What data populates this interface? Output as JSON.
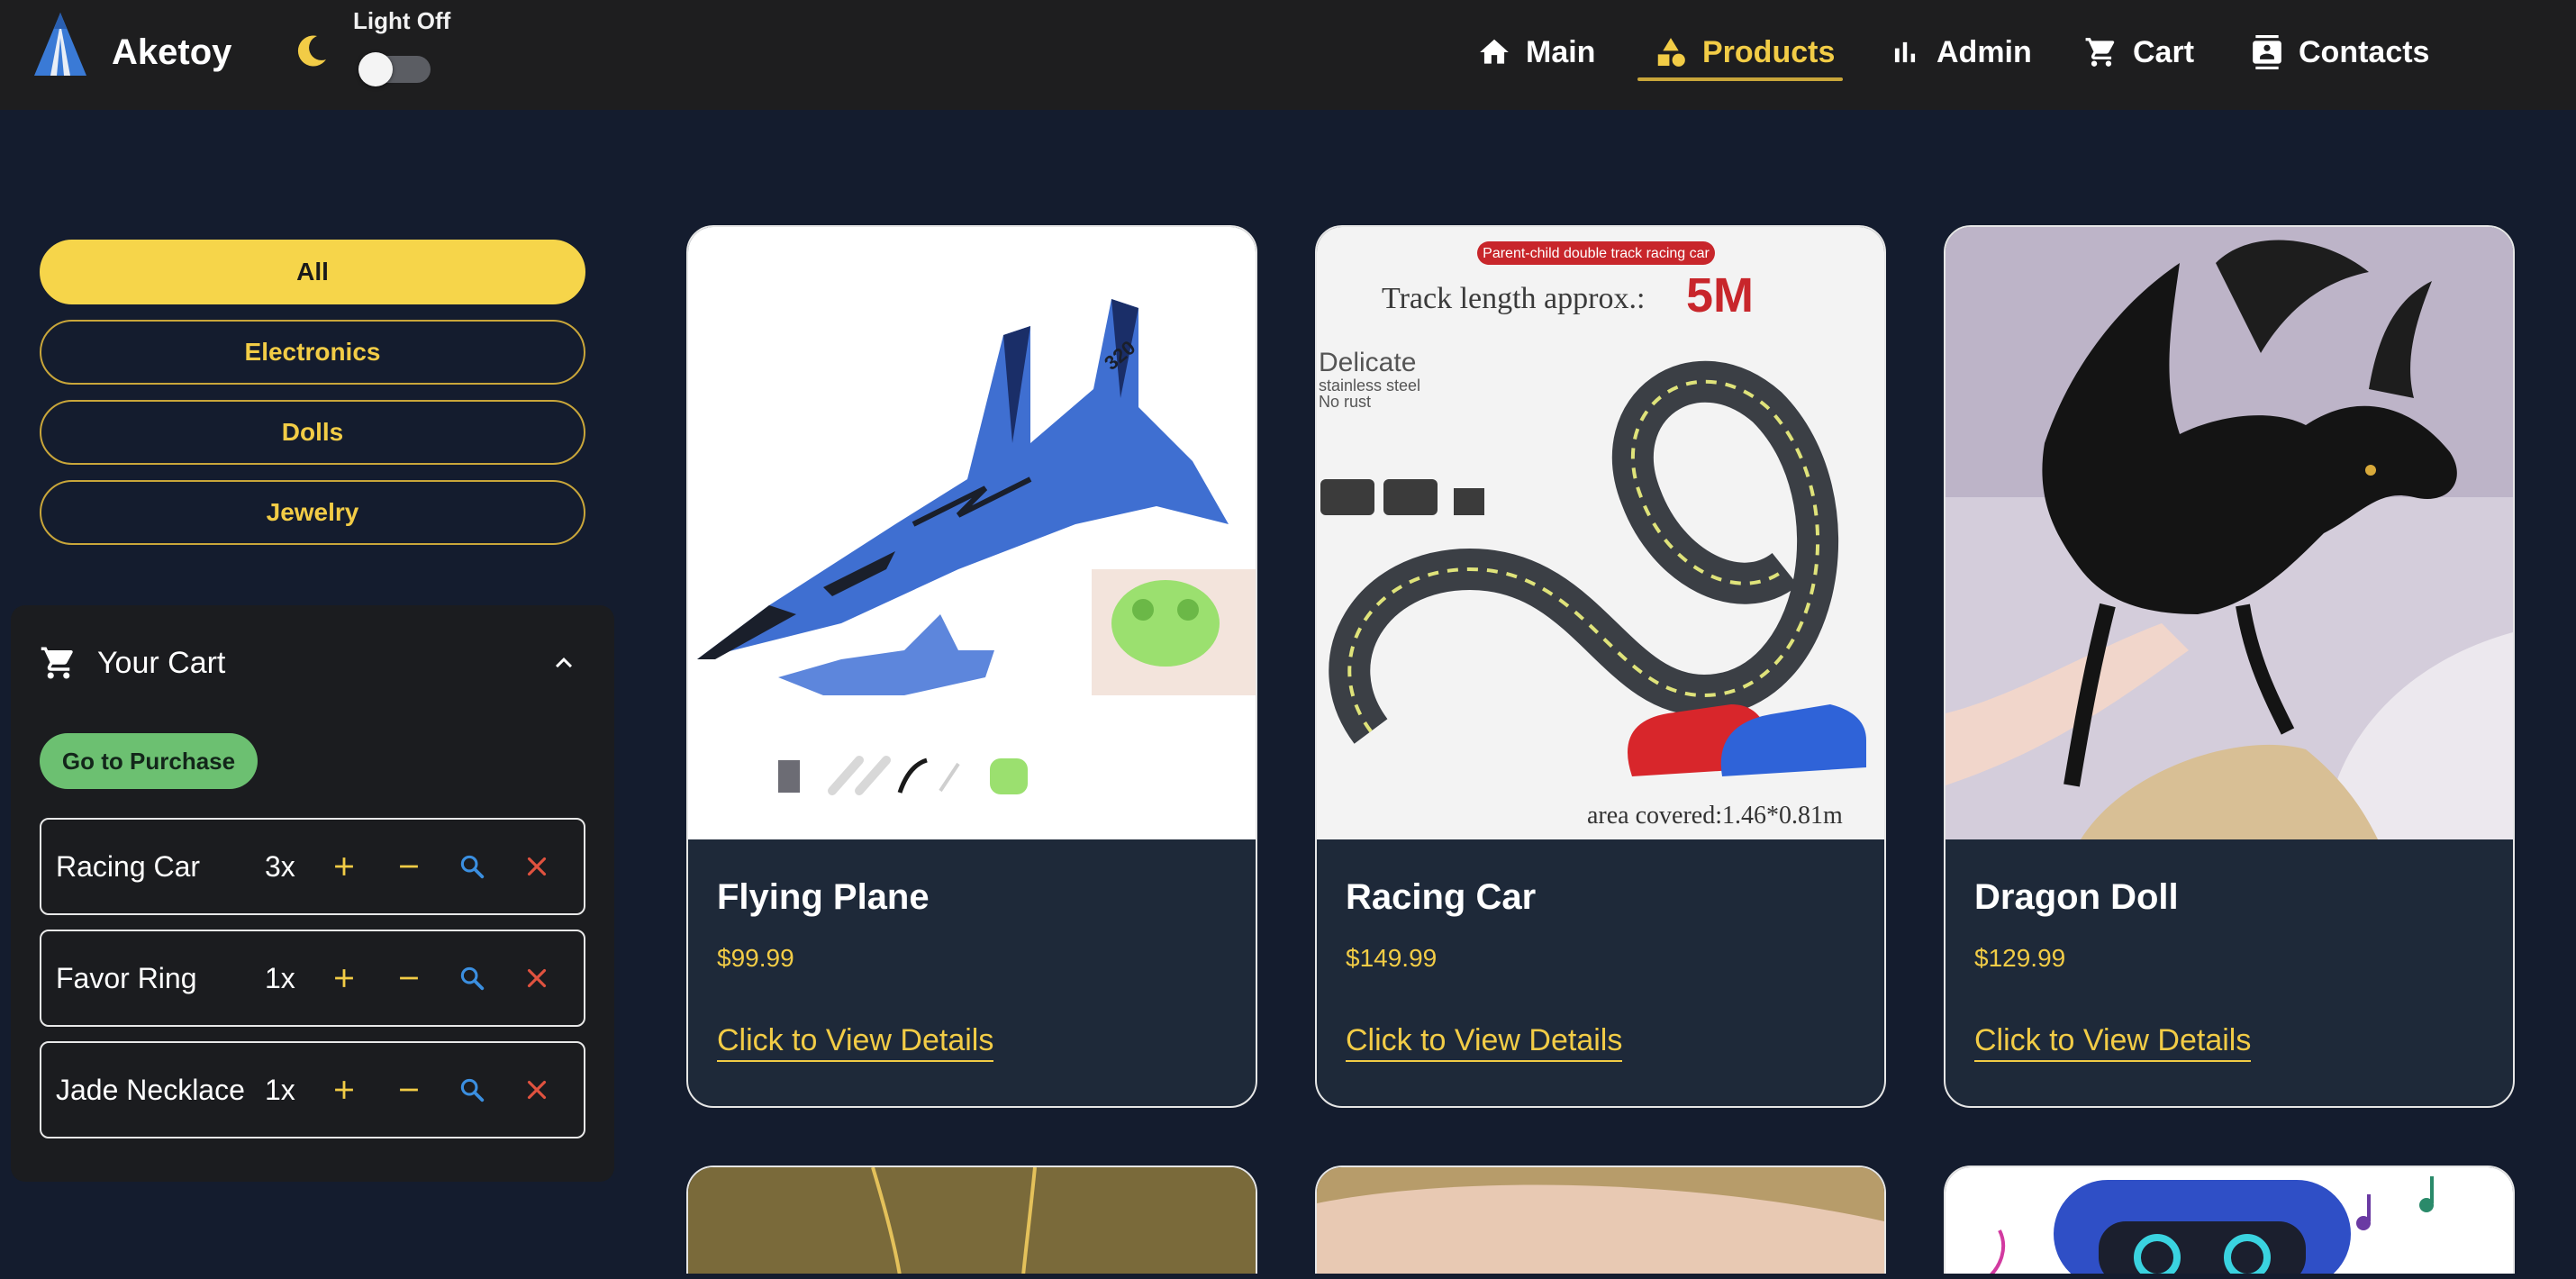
{
  "header": {
    "brand": "Aketoy",
    "theme_toggle_label": "Light Off",
    "nav": [
      {
        "label": "Main",
        "icon": "home-icon"
      },
      {
        "label": "Products",
        "icon": "shapes-icon",
        "active": true
      },
      {
        "label": "Admin",
        "icon": "bar-chart-icon"
      },
      {
        "label": "Cart",
        "icon": "cart-icon"
      },
      {
        "label": "Contacts",
        "icon": "contacts-icon"
      }
    ]
  },
  "filters": [
    {
      "label": "All",
      "active": true
    },
    {
      "label": "Electronics"
    },
    {
      "label": "Dolls"
    },
    {
      "label": "Jewelry"
    }
  ],
  "cart": {
    "title": "Your Cart",
    "purchase_label": "Go to Purchase",
    "items": [
      {
        "name": "Racing Car",
        "qty": "3x"
      },
      {
        "name": "Favor Ring",
        "qty": "1x"
      },
      {
        "name": "Jade Necklace",
        "qty": "1x"
      }
    ]
  },
  "products": [
    {
      "title": "Flying Plane",
      "price": "$99.99",
      "details_label": "Click to View Details"
    },
    {
      "title": "Racing Car",
      "price": "$149.99",
      "details_label": "Click to View Details"
    },
    {
      "title": "Dragon Doll",
      "price": "$129.99",
      "details_label": "Click to View Details"
    }
  ],
  "product_image_text": {
    "racing_banner": "Parent-child double track racing car",
    "racing_track_length": "Track length approx.:",
    "racing_track_value": "5M",
    "racing_delicate": "Delicate",
    "racing_steel": "stainless steel",
    "racing_rust": "No rust",
    "racing_area": "area covered:1.46*0.81m"
  },
  "colors": {
    "accent": "#f2cc46",
    "background": "#141c2e",
    "header": "#1e1e1f",
    "card": "#1e2939",
    "purchase": "#6cc071",
    "search": "#3b8fe0",
    "remove": "#e0523f"
  }
}
